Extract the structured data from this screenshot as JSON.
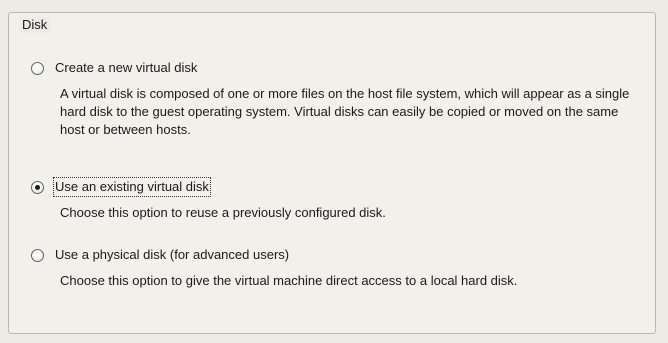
{
  "group": {
    "legend": "Disk"
  },
  "options": [
    {
      "label": "Create a new virtual disk",
      "description": "A virtual disk is composed of one or more files on the host file system, which will appear as a single hard disk to the guest operating system. Virtual disks can easily be copied or moved on the same host or between hosts.",
      "selected": false
    },
    {
      "label": "Use an existing virtual disk",
      "description": "Choose this option to reuse a previously configured disk.",
      "selected": true
    },
    {
      "label": "Use a physical disk (for advanced users)",
      "description": "Choose this option to give the virtual machine direct access to a local hard disk.",
      "selected": false
    }
  ]
}
